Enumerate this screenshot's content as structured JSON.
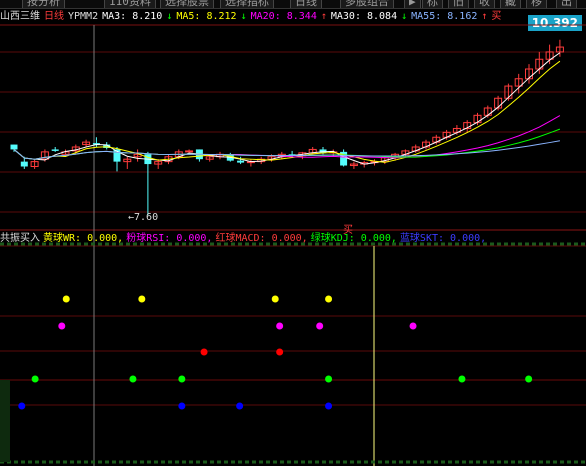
{
  "toolbar": {
    "items": [
      "按分析",
      "110资料",
      "选择股票",
      "选择指标",
      "日线",
      "多股组合",
      "▶",
      "标",
      "旧",
      "收",
      "藏",
      "移",
      "出"
    ]
  },
  "infobar": {
    "stock_name": "山西三维",
    "period": "日线",
    "indicator": "YPMM2",
    "ma3": "MA3: 8.210",
    "ma3_arrow": "↓",
    "ma5": "MA5: 8.212",
    "ma5_arrow": "↓",
    "ma20": "MA20: 8.344",
    "ma20_arrow": "↑",
    "ma30": "MA30: 8.084",
    "ma30_arrow": "↓",
    "ma55": "MA55: 8.162",
    "ma55_arrow": "↑",
    "buy": "买"
  },
  "price_label": "10.392",
  "low_annotation": "←7.60",
  "signal_annotation": "买",
  "indicator_bar": {
    "name": "共振买入",
    "yellow": "黄球WR: 0.000,",
    "magenta": "粉球RSI: 0.000,",
    "red": "红球MACD: 0.000,",
    "green": "绿球KDJ: 0.000,",
    "blue": "蓝球SKT: 0.000,"
  },
  "colors": {
    "up": "#ff3c3c",
    "down": "#54fcfc",
    "ma3": "#ffffff",
    "ma5": "#ffff00",
    "ma20": "#ff00ff",
    "ma30": "#00ff00",
    "ma55": "#8ab4ff",
    "yellow_ball": "#ffff00",
    "magenta_ball": "#ff00ff",
    "red_ball": "#ff0000",
    "green_ball": "#00ff00",
    "blue_ball": "#0000ff"
  },
  "candles": [
    [
      9.05,
      9.05,
      8.9,
      8.95
    ],
    [
      8.7,
      8.8,
      8.55,
      8.6
    ],
    [
      8.6,
      8.75,
      8.55,
      8.7
    ],
    [
      8.75,
      8.95,
      8.7,
      8.9
    ],
    [
      8.95,
      9.0,
      8.9,
      8.92
    ],
    [
      8.85,
      8.95,
      8.8,
      8.9
    ],
    [
      8.92,
      9.05,
      8.85,
      9.0
    ],
    [
      9.05,
      9.15,
      9.0,
      9.1
    ],
    [
      9.08,
      9.2,
      9.0,
      9.05
    ],
    [
      9.05,
      9.1,
      8.95,
      8.98
    ],
    [
      8.95,
      9.0,
      8.5,
      8.7
    ],
    [
      8.7,
      8.8,
      8.55,
      8.75
    ],
    [
      8.8,
      8.95,
      8.7,
      8.85
    ],
    [
      8.85,
      8.9,
      7.6,
      8.65
    ],
    [
      8.65,
      8.75,
      8.55,
      8.7
    ],
    [
      8.7,
      8.85,
      8.65,
      8.8
    ],
    [
      8.8,
      8.95,
      8.75,
      8.9
    ],
    [
      8.9,
      8.95,
      8.85,
      8.92
    ],
    [
      8.95,
      8.95,
      8.7,
      8.75
    ],
    [
      8.75,
      8.85,
      8.7,
      8.8
    ],
    [
      8.8,
      8.9,
      8.75,
      8.85
    ],
    [
      8.85,
      8.88,
      8.7,
      8.72
    ],
    [
      8.72,
      8.8,
      8.65,
      8.68
    ],
    [
      8.68,
      8.75,
      8.6,
      8.7
    ],
    [
      8.7,
      8.8,
      8.65,
      8.75
    ],
    [
      8.75,
      8.85,
      8.7,
      8.8
    ],
    [
      8.8,
      8.9,
      8.75,
      8.85
    ],
    [
      8.85,
      8.92,
      8.8,
      8.82
    ],
    [
      8.82,
      8.9,
      8.75,
      8.88
    ],
    [
      8.88,
      9.0,
      8.85,
      8.95
    ],
    [
      8.95,
      9.0,
      8.85,
      8.88
    ],
    [
      8.88,
      8.95,
      8.8,
      8.9
    ],
    [
      8.9,
      8.95,
      8.6,
      8.62
    ],
    [
      8.62,
      8.7,
      8.55,
      8.65
    ],
    [
      8.65,
      8.72,
      8.58,
      8.68
    ],
    [
      8.68,
      8.75,
      8.62,
      8.7
    ],
    [
      8.7,
      8.8,
      8.65,
      8.78
    ],
    [
      8.78,
      8.88,
      8.72,
      8.85
    ],
    [
      8.85,
      8.95,
      8.8,
      8.92
    ],
    [
      8.92,
      9.05,
      8.88,
      9.0
    ],
    [
      9.0,
      9.15,
      8.95,
      9.1
    ],
    [
      9.1,
      9.25,
      9.05,
      9.2
    ],
    [
      9.2,
      9.35,
      9.15,
      9.3
    ],
    [
      9.3,
      9.45,
      9.25,
      9.38
    ],
    [
      9.38,
      9.55,
      9.3,
      9.5
    ],
    [
      9.5,
      9.7,
      9.45,
      9.65
    ],
    [
      9.65,
      9.85,
      9.6,
      9.8
    ],
    [
      9.8,
      10.05,
      9.75,
      10.0
    ],
    [
      10.0,
      10.3,
      9.95,
      10.25
    ],
    [
      10.25,
      10.5,
      10.1,
      10.4
    ],
    [
      10.4,
      10.7,
      10.3,
      10.6
    ],
    [
      10.6,
      10.95,
      10.5,
      10.8
    ],
    [
      10.8,
      11.1,
      10.7,
      10.95
    ],
    [
      10.95,
      11.2,
      10.85,
      11.05
    ]
  ],
  "signals": {
    "yellow": [
      14,
      31,
      61,
      73
    ],
    "magenta": [
      13,
      62,
      71,
      92
    ],
    "red": [
      45,
      62
    ],
    "green": [
      7,
      29,
      40,
      73,
      103,
      118
    ],
    "blue": [
      4,
      40,
      53,
      73
    ]
  },
  "signal_total_bars": 130
}
